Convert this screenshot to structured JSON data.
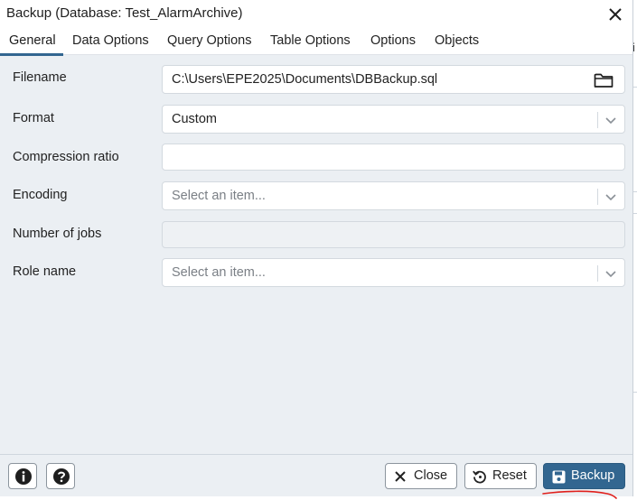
{
  "dialog": {
    "title": "Backup (Database: Test_AlarmArchive)"
  },
  "tabs": [
    {
      "label": "General",
      "active": true
    },
    {
      "label": "Data Options"
    },
    {
      "label": "Query Options"
    },
    {
      "label": "Table Options"
    },
    {
      "label": "Options"
    },
    {
      "label": "Objects"
    }
  ],
  "form": {
    "filename": {
      "label": "Filename",
      "value": "C:\\Users\\EPE2025\\Documents\\DBBackup.sql"
    },
    "format": {
      "label": "Format",
      "value": "Custom"
    },
    "compression": {
      "label": "Compression ratio",
      "value": ""
    },
    "encoding": {
      "label": "Encoding",
      "placeholder": "Select an item..."
    },
    "jobs": {
      "label": "Number of jobs",
      "value": ""
    },
    "role": {
      "label": "Role name",
      "placeholder": "Select an item..."
    }
  },
  "footer": {
    "close_label": "Close",
    "reset_label": "Reset",
    "backup_label": "Backup"
  },
  "background": {
    "fragment": "i"
  },
  "colors": {
    "accent": "#326690",
    "annotation": "#e0201c"
  }
}
